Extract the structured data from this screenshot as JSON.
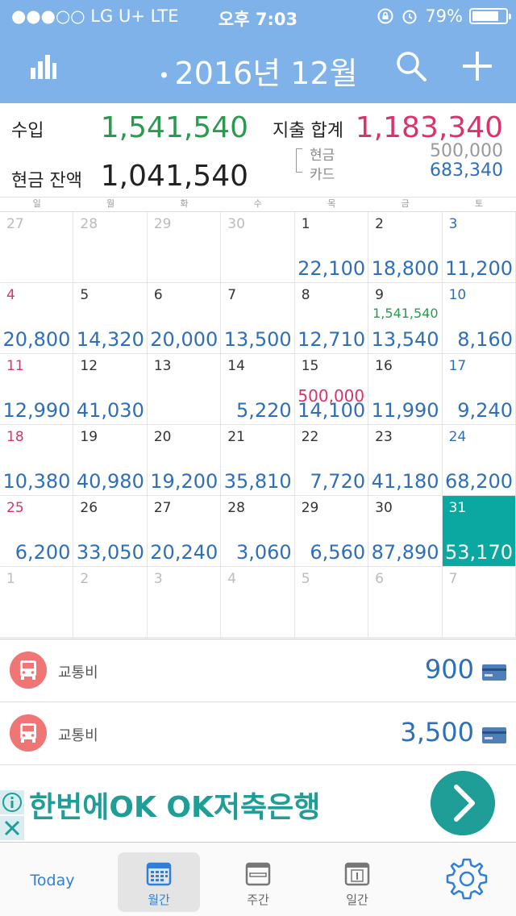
{
  "status": {
    "carrier": "●●●○○ LG U+  LTE",
    "time": "오후 7:03",
    "battery": "79%",
    "battery_level": 0.79
  },
  "header": {
    "title": "2016년 12월"
  },
  "summary": {
    "income_label": "수입",
    "income": "1,541,540",
    "expense_label": "지출 합계",
    "expense": "1,183,340",
    "balance_label": "현금 잔액",
    "balance": "1,041,540",
    "cash_label": "현금",
    "cash": "500,000",
    "card_label": "카드",
    "card": "683,340"
  },
  "weekdays": [
    "일",
    "월",
    "화",
    "수",
    "목",
    "금",
    "토"
  ],
  "calendar": [
    {
      "day": "27",
      "other": true
    },
    {
      "day": "28",
      "other": true
    },
    {
      "day": "29",
      "other": true
    },
    {
      "day": "30",
      "other": true
    },
    {
      "day": "1",
      "amount": "22,100"
    },
    {
      "day": "2",
      "amount": "18,800"
    },
    {
      "day": "3",
      "amount": "11,200"
    },
    {
      "day": "4",
      "amount": "20,800"
    },
    {
      "day": "5",
      "amount": "14,320"
    },
    {
      "day": "6",
      "amount": "20,000"
    },
    {
      "day": "7",
      "amount": "13,500"
    },
    {
      "day": "8",
      "amount": "12,710"
    },
    {
      "day": "9",
      "amount": "13,540",
      "income": "1,541,540"
    },
    {
      "day": "10",
      "amount": "8,160"
    },
    {
      "day": "11",
      "amount": "12,990"
    },
    {
      "day": "12",
      "amount": "41,030"
    },
    {
      "day": "13"
    },
    {
      "day": "14",
      "amount": "5,220"
    },
    {
      "day": "15",
      "amount": "14,100",
      "cash": "500,000"
    },
    {
      "day": "16",
      "amount": "11,990"
    },
    {
      "day": "17",
      "amount": "9,240"
    },
    {
      "day": "18",
      "amount": "10,380"
    },
    {
      "day": "19",
      "amount": "40,980"
    },
    {
      "day": "20",
      "amount": "19,200"
    },
    {
      "day": "21",
      "amount": "35,810"
    },
    {
      "day": "22",
      "amount": "7,720"
    },
    {
      "day": "23",
      "amount": "41,180"
    },
    {
      "day": "24",
      "amount": "68,200"
    },
    {
      "day": "25",
      "amount": "6,200"
    },
    {
      "day": "26",
      "amount": "33,050"
    },
    {
      "day": "27",
      "amount": "20,240"
    },
    {
      "day": "28",
      "amount": "3,060"
    },
    {
      "day": "29",
      "amount": "6,560"
    },
    {
      "day": "30",
      "amount": "87,890"
    },
    {
      "day": "31",
      "amount": "53,170",
      "selected": true
    },
    {
      "day": "1",
      "other": true
    },
    {
      "day": "2",
      "other": true
    },
    {
      "day": "3",
      "other": true
    },
    {
      "day": "4",
      "other": true
    },
    {
      "day": "5",
      "other": true
    },
    {
      "day": "6",
      "other": true
    },
    {
      "day": "7",
      "other": true
    }
  ],
  "transactions": [
    {
      "label": "교통비",
      "amount": "900",
      "icon": "bus-icon"
    },
    {
      "label": "교통비",
      "amount": "3,500",
      "icon": "bus-icon"
    }
  ],
  "ad": {
    "text": "한번에OK OK저축은행"
  },
  "tabs": {
    "today": "Today",
    "month": "월간",
    "week": "주간",
    "day": "일간"
  },
  "colors": {
    "header": "#7fb2e8",
    "income": "#2a9a4f",
    "expense": "#d8336a",
    "amount": "#2f6fb7",
    "selected": "#0aa8a0"
  }
}
